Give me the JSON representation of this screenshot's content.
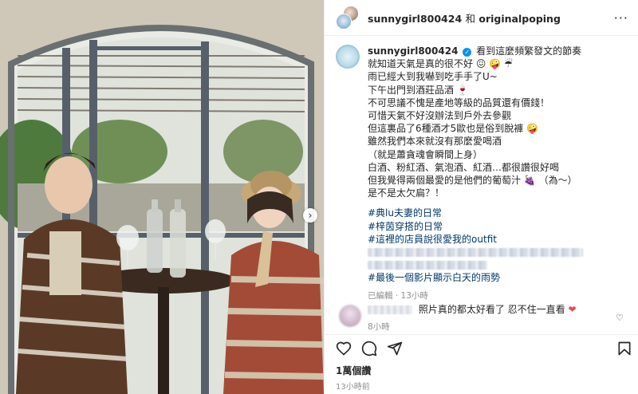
{
  "header": {
    "user1": "sunnygirl800424",
    "and": "和",
    "user2": "originalpoping",
    "more": "···"
  },
  "caption": {
    "username": "sunnygirl800424",
    "verified": "✓",
    "lines": [
      "看到這麼頻繁發文的節奏",
      "就知道天氣是真的很不好 😖 🤪 ☔",
      "雨已經大到我嚇到吃手手了U~",
      "下午出門到酒莊品酒 🍷",
      "不可思議不愧是產地等級的品質還有價錢！",
      "可惜天氣不好沒辦法到戶外去參觀",
      "但這裏品了6種酒才5歐也是俗到脫褲 🤪",
      "雖然我們本來就沒有那麼愛喝酒",
      "（就是蕭貪魂會瞬間上身）",
      "白酒、粉紅酒、氣泡酒、紅酒…都很讚很好喝",
      "但我覺得兩個最愛的是他們的葡萄汁 🍇 （為～）",
      "是不是太欠扁？！"
    ],
    "tags": [
      "#典lu夫妻的日常",
      "#梓茵穿搭的日常",
      "#這裡的店員說很愛我的outfit",
      "#最後一個影片顯示白天的雨勢"
    ],
    "edited": "已編輯",
    "dot": "·",
    "time": "13小時"
  },
  "comment": {
    "text": "照片真的都太好看了 忍不住一直看",
    "heart": "❤",
    "time": "8小時",
    "like_icon": "♡"
  },
  "actions": {
    "icons": [
      "heart-icon",
      "comment-icon",
      "share-icon",
      "bookmark-icon"
    ]
  },
  "likes": "1萬個讚",
  "post_time": "13小時前",
  "photo": {
    "next_arrow": "›"
  },
  "colors": {
    "link": "#00376b",
    "verified": "#0095f6",
    "muted": "#8e8e8e",
    "heart": "#ed4956"
  }
}
